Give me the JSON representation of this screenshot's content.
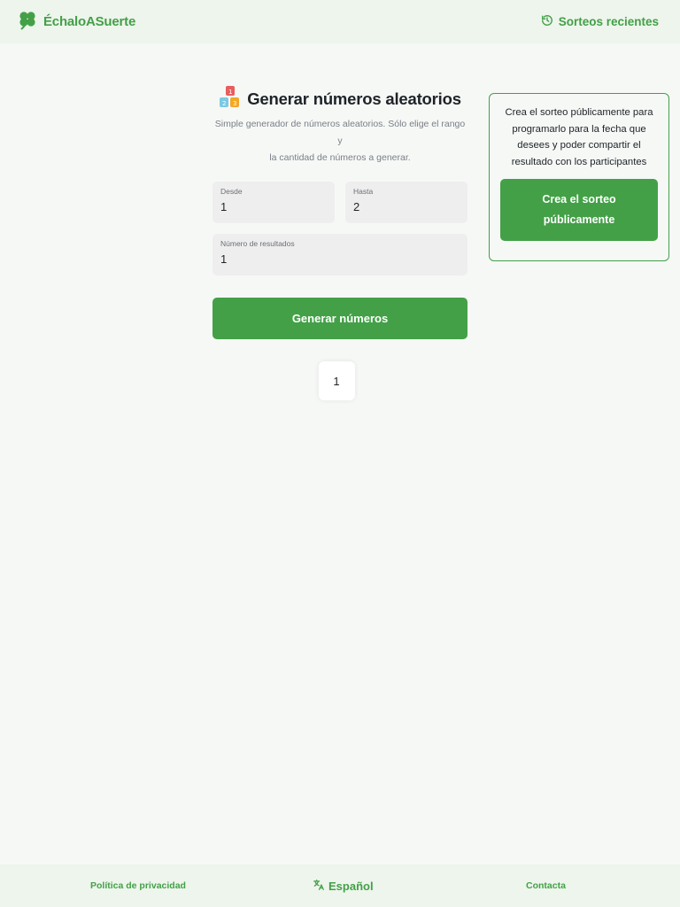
{
  "header": {
    "brand": "ÉchaloASuerte",
    "recent_label": "Sorteos recientes"
  },
  "main": {
    "title": "Generar números aleatorios",
    "subtitle_line1": "Simple generador de números aleatorios. Sólo elige el rango y",
    "subtitle_line2": "la cantidad de números a generar.",
    "fields": {
      "from_label": "Desde",
      "from_value": "1",
      "to_label": "Hasta",
      "to_value": "2",
      "count_label": "Número de resultados",
      "count_value": "1"
    },
    "generate_label": "Generar números",
    "results": [
      "1"
    ]
  },
  "side": {
    "text_line1": "Crea el sorteo públicamente para",
    "text_line2": "programarlo para la fecha que",
    "text_line3": "desees y poder compartir el",
    "text_line4": "resultado con los participantes",
    "button_label": "Crea el sorteo públicamente"
  },
  "footer": {
    "privacy": "Política de privacidad",
    "language": "Español",
    "contact": "Contacta"
  },
  "colors": {
    "accent": "#43a047",
    "header_bg": "#edf5ec",
    "page_bg": "#f6f8f6"
  },
  "icons": [
    "clover-icon",
    "history-icon",
    "number-blocks-icon",
    "translate-icon"
  ]
}
